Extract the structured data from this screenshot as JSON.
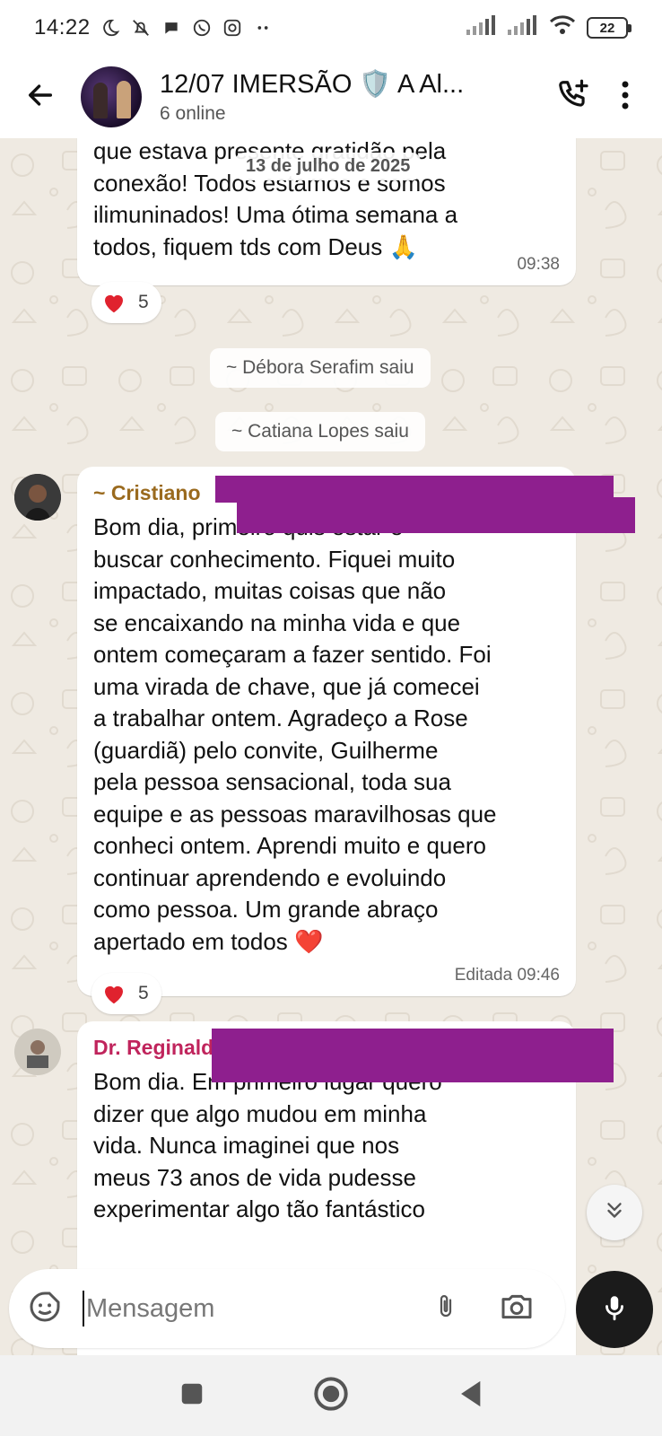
{
  "status_bar": {
    "time": "14:22",
    "battery": "22"
  },
  "header": {
    "title": "12/07 IMERSÃO 🛡️ A Al...",
    "subtitle": "6 online"
  },
  "chat": {
    "date_chip": "13 de julho de 2025",
    "message1": {
      "lines": [
        "que estava presente gratidão pela",
        "conexão! Todos estamos e somos",
        "ilimuninados! Uma ótima semana a",
        "todos, fiquem tds com Deus 🙏"
      ],
      "time": "09:38",
      "reaction_count": "5"
    },
    "system1": "~ Débora Serafim saiu",
    "system2": "~ Catiana Lopes saiu",
    "message2": {
      "sender": "~ Cristiano",
      "sender_color": "#9a6a1e",
      "lines": [
        "Bom dia, primeiro quis estar  e",
        "buscar conhecimento. Fiquei muito",
        "impactado, muitas coisas que não",
        "se encaixando na minha vida e que",
        "ontem começaram a fazer sentido. Foi",
        "uma virada de chave, que já comecei",
        "a trabalhar ontem. Agradeço a Rose",
        "(guardiã) pelo convite, Guilherme",
        "pela pessoa sensacional, toda sua",
        "equipe e as pessoas maravilhosas que",
        "conheci ontem. Aprendi muito e quero",
        "continuar aprendendo e evoluindo",
        "como pessoa. Um grande abraço",
        "apertado em todos ❤️"
      ],
      "time": "Editada 09:46",
      "reaction_count": "5"
    },
    "message3": {
      "sender": "Dr. Reginald",
      "sender_color": "#c0245c",
      "lines": [
        "Bom dia.  Em primeiro  lugar quero",
        "dizer que algo mudou em minha",
        "vida. Nunca imaginei  que nos",
        "meus 73 anos de vida pudesse",
        "experimentar  algo tão fantástico"
      ]
    }
  },
  "composer": {
    "placeholder": "Mensagem"
  },
  "colors": {
    "redaction": "#8e1f8e",
    "reaction_heart": "#e0222e"
  },
  "icons": [
    "back-arrow-icon",
    "add-call-icon",
    "more-options-icon",
    "sticker-icon",
    "attach-icon",
    "camera-icon",
    "mic-icon",
    "scroll-down-icon",
    "nav-recents-icon",
    "nav-home-icon",
    "nav-back-icon"
  ]
}
